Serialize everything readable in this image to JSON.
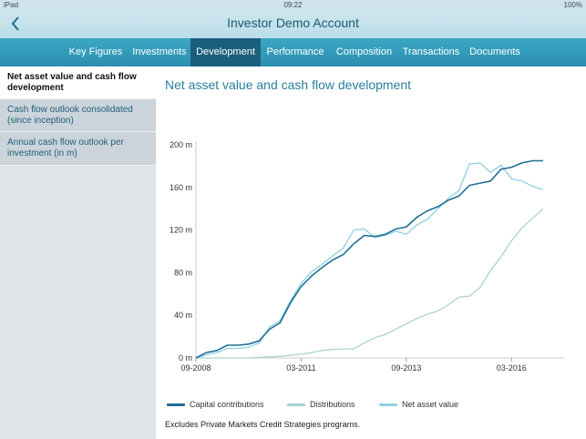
{
  "status_bar": {
    "carrier": "iPad",
    "time": "09:22",
    "battery": "100%"
  },
  "header": {
    "title": "Investor Demo Account",
    "back_icon": "chevron-left-icon"
  },
  "tabs": [
    {
      "label": "Key Figures",
      "active": false
    },
    {
      "label": "Investments",
      "active": false
    },
    {
      "label": "Development",
      "active": true
    },
    {
      "label": "Performance",
      "active": false
    },
    {
      "label": "Composition",
      "active": false
    },
    {
      "label": "Transactions",
      "active": false
    },
    {
      "label": "Documents",
      "active": false
    }
  ],
  "sidebar": {
    "items": [
      {
        "label": "Net asset value and cash flow development",
        "active": true
      },
      {
        "label": "Cash flow outlook consolidated (since inception)",
        "active": false
      },
      {
        "label": "Annual cash flow outlook per investment (in m)",
        "active": false
      }
    ]
  },
  "main": {
    "title": "Net asset value and cash flow development",
    "footnote": "Excludes Private Markets Credit Strategies programs."
  },
  "colors": {
    "capital_contributions": "#1f6f96",
    "distributions": "#a9d3cf",
    "net_asset_value": "#8fd0e0",
    "accent": "#2a7f9e"
  },
  "chart_data": {
    "type": "line",
    "x_tick_labels": [
      "09-2008",
      "03-2011",
      "09-2013",
      "03-2016"
    ],
    "y_tick_labels": [
      "200 m",
      "160 m",
      "120 m",
      "80 m",
      "40 m",
      "0 m"
    ],
    "ylim": [
      0,
      200
    ],
    "x_range_quarters": [
      0,
      35
    ],
    "x_ticks_quarters": [
      0,
      10,
      20,
      30
    ],
    "series": [
      {
        "name": "Capital contributions",
        "values": [
          0,
          5,
          7,
          12,
          12,
          13,
          16,
          27,
          33,
          52,
          67,
          77,
          85,
          92,
          97,
          107,
          115,
          114,
          116,
          121,
          123,
          132,
          138,
          142,
          148,
          152,
          162,
          164,
          166,
          177,
          179,
          183,
          185,
          185
        ]
      },
      {
        "name": "Distributions",
        "values": [
          0,
          0,
          0,
          0,
          0,
          0,
          0.5,
          1,
          1.5,
          2.5,
          3.5,
          5,
          7,
          8,
          8.5,
          8.5,
          14,
          19,
          22,
          27,
          32,
          37,
          41,
          44,
          50,
          57,
          58,
          66,
          82,
          95,
          110,
          122,
          131,
          140
        ]
      },
      {
        "name": "Net asset value",
        "values": [
          0,
          3,
          5,
          9,
          9,
          10,
          14,
          29,
          35,
          54,
          70,
          81,
          88,
          96,
          103,
          120,
          121,
          113,
          115,
          119,
          116,
          125,
          130,
          140,
          150,
          157,
          182,
          183,
          174,
          181,
          168,
          166,
          161,
          158
        ]
      }
    ]
  }
}
